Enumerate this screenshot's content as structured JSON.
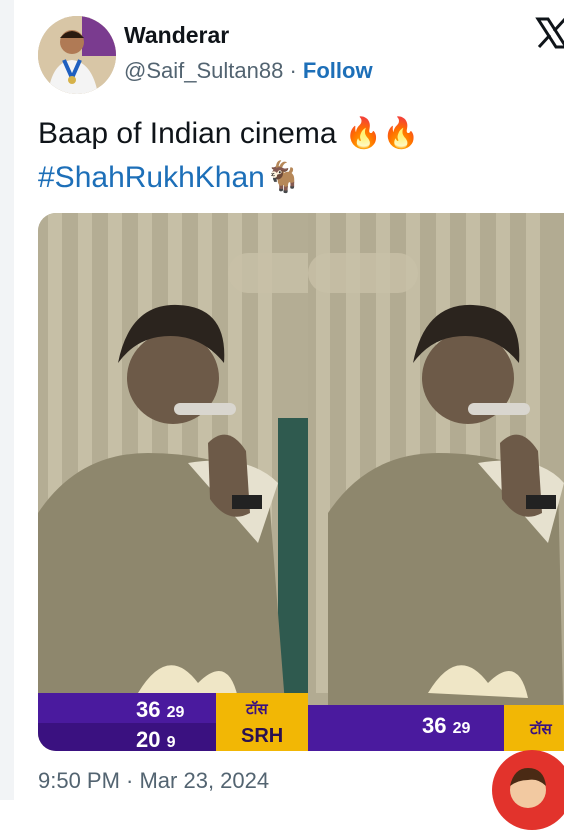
{
  "tweet": {
    "author_name": "Wanderar",
    "handle": "@Saif_Sultan88",
    "separator": "·",
    "follow_label": "Follow",
    "text": "Baap of Indian cinema 🔥🔥",
    "hashtag": "#ShahRukhKhan🐐",
    "timestamp": "9:50 PM · Mar 23, 2024"
  },
  "media": {
    "left_frame": {
      "score_top": "36",
      "score_top_small": "29",
      "score_bottom": "20",
      "score_bottom_small": "9",
      "tag_top": "टॉस",
      "tag_bottom": "SRH"
    },
    "right_frame": {
      "score_top": "36",
      "score_top_small": "29",
      "tag_top": "टॉस"
    }
  },
  "colors": {
    "link": "#1d6fb8",
    "scorebar_purple": "#4a1a9e",
    "scorebar_gold": "#f2b705",
    "fab_red": "#e2332c"
  }
}
